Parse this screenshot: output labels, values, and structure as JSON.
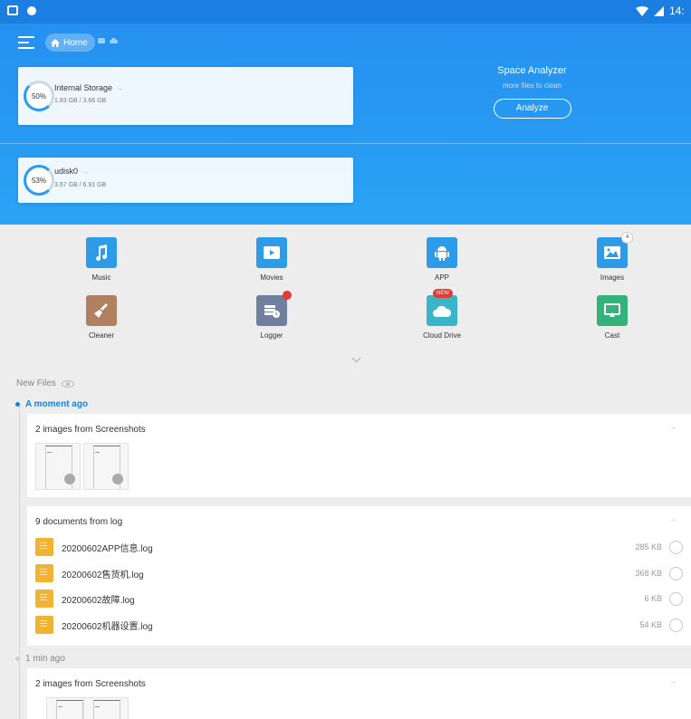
{
  "status_bar": {
    "time": "14:"
  },
  "header": {
    "breadcrumb_home": "Home",
    "storages": [
      {
        "percent": "50%",
        "name": "Internal Storage",
        "size": "1.83 GB / 3.66 GB"
      },
      {
        "percent": "53%",
        "name": "udisk0",
        "size": "3.67 GB / 6.91 GB"
      }
    ],
    "analyzer": {
      "title": "Space Analyzer",
      "subtitle": "more files to clean",
      "button": "Analyze"
    }
  },
  "categories": [
    {
      "label": "Music",
      "icon": "music-icon",
      "color": "#2e9be6"
    },
    {
      "label": "Movies",
      "icon": "movie-icon",
      "color": "#2e9be6"
    },
    {
      "label": "APP",
      "icon": "android-icon",
      "color": "#2e9be6"
    },
    {
      "label": "Images",
      "icon": "image-icon",
      "color": "#2e9be6",
      "badge": "4"
    },
    {
      "label": "Cleaner",
      "icon": "broom-icon",
      "color": "#b08060"
    },
    {
      "label": "Logger",
      "icon": "logger-icon",
      "color": "#6f7f9e"
    },
    {
      "label": "Cloud Drive",
      "icon": "cloud-icon",
      "color": "#38b6c8",
      "badge": "NEW"
    },
    {
      "label": "Cast",
      "icon": "cast-icon",
      "color": "#33b37a"
    }
  ],
  "new_files": {
    "title": "New Files",
    "groups": [
      {
        "time": "A moment ago",
        "cards": [
          {
            "title": "2 images from Screenshots"
          },
          {
            "title": "9 documents from log",
            "files": [
              {
                "name": "20200602APP信息.log",
                "size": "285 KB"
              },
              {
                "name": "20200602售货机.log",
                "size": "368 KB"
              },
              {
                "name": "20200602故障.log",
                "size": "6 KB"
              },
              {
                "name": "20200602机器设置.log",
                "size": "54 KB"
              }
            ]
          }
        ]
      },
      {
        "time": "1 min ago",
        "cards": [
          {
            "title": "2 images from Screenshots"
          }
        ]
      }
    ]
  },
  "colors": {
    "accent": "#1a7fe0",
    "header_blue": "#2a9bf2",
    "file_yellow": "#f2b333",
    "badge_red": "#e53935"
  }
}
